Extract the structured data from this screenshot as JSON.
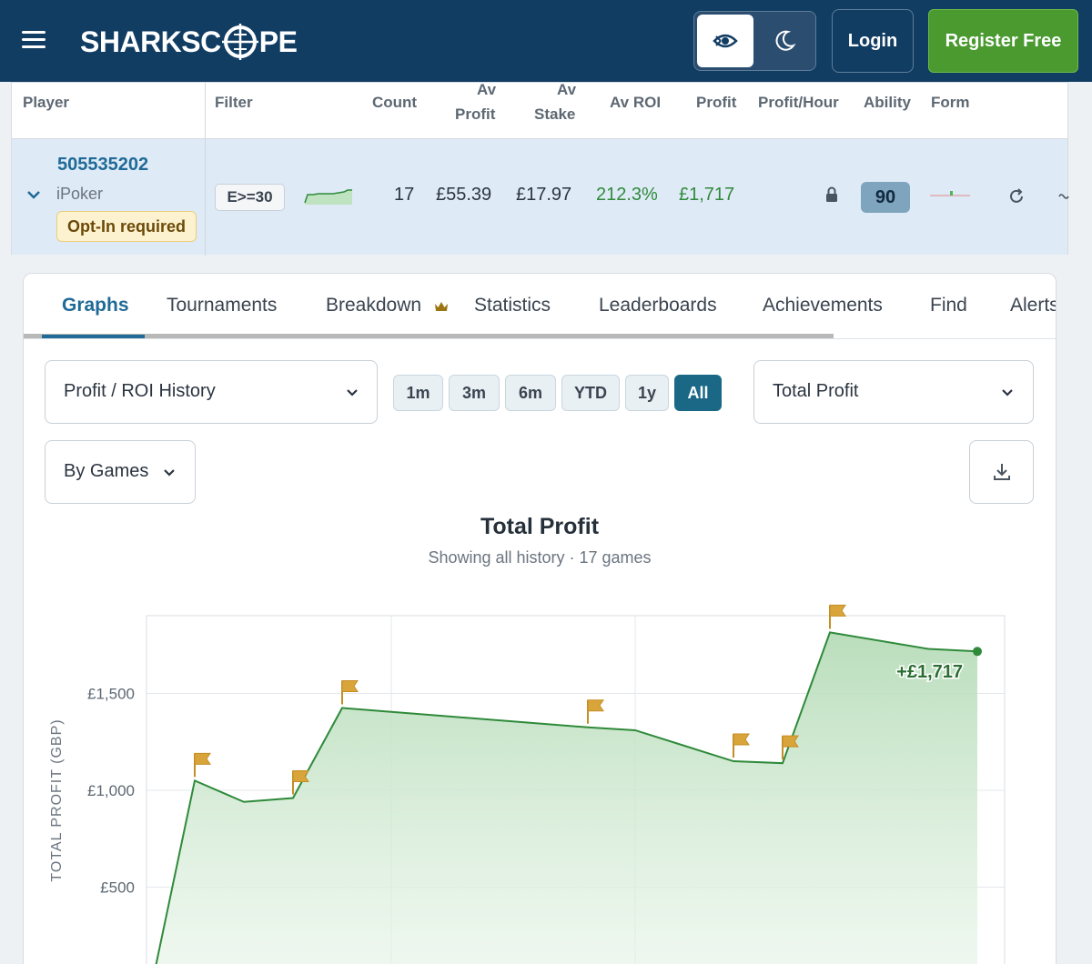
{
  "header": {
    "logo_left": "SHARKSC",
    "logo_right": "PE",
    "login_label": "Login",
    "register_label": "Register Free",
    "theme_light_icon": "eye-icon",
    "theme_dark_icon": "moon-icon"
  },
  "player_table": {
    "headers": {
      "player": "Player",
      "filter": "Filter",
      "count": "Count",
      "av_profit_1": "Av",
      "av_profit_2": "Profit",
      "av_stake_1": "Av",
      "av_stake_2": "Stake",
      "av_roi": "Av ROI",
      "profit": "Profit",
      "profit_hour": "Profit/Hour",
      "ability": "Ability",
      "form": "Form"
    },
    "row": {
      "player_id": "505535202",
      "network": "iPoker",
      "optin": "Opt-In required",
      "filter": "E>=30",
      "count": "17",
      "av_profit": "£55.39",
      "av_stake": "£17.97",
      "av_roi": "212.3%",
      "profit": "£1,717",
      "ability": "90",
      "lock_icon": "lock-icon",
      "refresh_icon": "refresh-icon"
    }
  },
  "tabs": [
    {
      "label": "Graphs",
      "active": true
    },
    {
      "label": "Tournaments"
    },
    {
      "label": "Breakdown"
    },
    {
      "label": "Statistics"
    },
    {
      "label": "Leaderboards"
    },
    {
      "label": "Achievements"
    },
    {
      "label": "Find"
    },
    {
      "label": "Alerts"
    }
  ],
  "controls": {
    "graph_select": "Profit / ROI History",
    "metric_select": "Total Profit",
    "by_select": "By Games",
    "ranges": [
      "1m",
      "3m",
      "6m",
      "YTD",
      "1y",
      "All"
    ],
    "active_range": "All"
  },
  "colors": {
    "header_bg": "#123d63",
    "accent": "#1f6a96",
    "register_green": "#4a9a30",
    "line_green": "#2f8a3a",
    "flag_gold": "#d9a53b"
  },
  "chart_data": {
    "type": "area",
    "title": "Total Profit",
    "subtitle": "Showing all history · 17 games",
    "ylabel": "TOTAL PROFIT (GBP)",
    "ylim": [
      0,
      1950
    ],
    "yticks": [
      500,
      1000,
      1500
    ],
    "ytick_labels": [
      "£500",
      "£1,000",
      "£1,500"
    ],
    "x": [
      0,
      1,
      2,
      3,
      4,
      5,
      6,
      7,
      8,
      9,
      10,
      11,
      12,
      13,
      14,
      15,
      16
    ],
    "values": [
      0,
      1050,
      940,
      960,
      1425,
      1405,
      1385,
      1365,
      1345,
      1325,
      1310,
      1230,
      1150,
      1140,
      1815,
      1730,
      1717
    ],
    "flag_indices": [
      1,
      3,
      4,
      9,
      12,
      13,
      14
    ],
    "end_label": "+£1,717",
    "grid": true
  }
}
